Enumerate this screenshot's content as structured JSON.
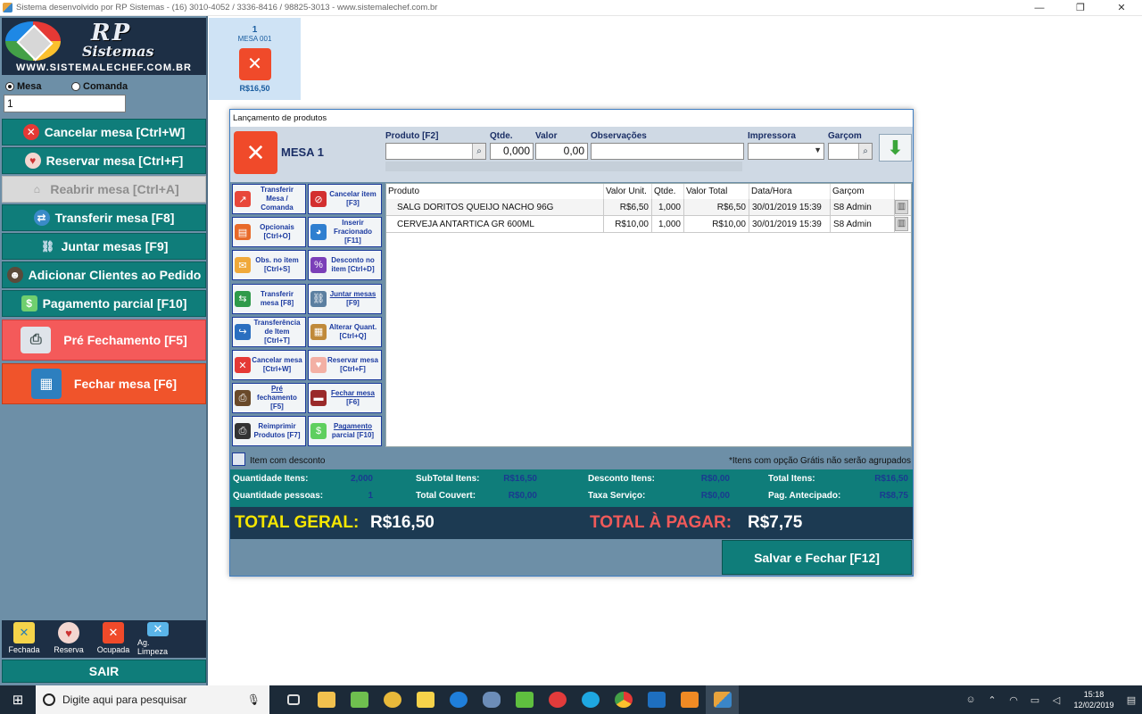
{
  "window": {
    "title": "Sistema desenvolvido por RP Sistemas - (16) 3010-4052 / 3336-8416 / 98825-3013 - www.sistemalechef.com.br",
    "minimize": "—",
    "restore": "❐",
    "close": "✕"
  },
  "logo": {
    "rp": "RP",
    "sistemas": "Sistemas",
    "url": "WWW.SISTEMALECHEF.COM.BR"
  },
  "left": {
    "radio_mesa": "Mesa",
    "radio_comanda": "Comanda",
    "mesa_value": "1",
    "buttons": {
      "cancelar": "Cancelar mesa [Ctrl+W]",
      "reservar": "Reservar mesa [Ctrl+F]",
      "reabrir": "Reabrir mesa [Ctrl+A]",
      "transferir": "Transferir mesa [F8]",
      "juntar": "Juntar mesas [F9]",
      "adicionar": "Adicionar Clientes ao Pedido",
      "pagamento": "Pagamento parcial [F10]",
      "pre_fechamento": "Pré Fechamento [F5]",
      "fechar": "Fechar mesa [F6]"
    },
    "legend": [
      "Fechada",
      "Reserva",
      "Ocupada",
      "Ag. Limpeza"
    ],
    "sair": "SAIR"
  },
  "tile": {
    "number": "1",
    "name": "MESA 001",
    "value": "R$16,50"
  },
  "dialog": {
    "title": "Lançamento de produtos",
    "mesa": "MESA 1",
    "labels": {
      "produto": "Produto [F2]",
      "qtde": "Qtde.",
      "valor": "Valor",
      "obs": "Observações",
      "impressora": "Impressora",
      "garcom": "Garçom"
    },
    "fields": {
      "produto": "",
      "qtde": "0,000",
      "valor": "0,00",
      "obs": "",
      "impressora": "",
      "garcom": ""
    },
    "actions": [
      [
        "Transferir",
        "Mesa /",
        "Comanda"
      ],
      [
        "Cancelar item",
        "[F3]"
      ],
      [
        "Opcionais",
        "[Ctrl+O]"
      ],
      [
        "Inserir",
        "Fracionado",
        "[F11]"
      ],
      [
        "Obs. no item",
        "[Ctrl+S]"
      ],
      [
        "Desconto no",
        "item [Ctrl+D]"
      ],
      [
        "Transferir",
        "mesa [F8]"
      ],
      [
        "Juntar mesas",
        "[F9]"
      ],
      [
        "Transferência",
        "de Item",
        "[Ctrl+T]"
      ],
      [
        "Alterar Quant.",
        "[Ctrl+Q]"
      ],
      [
        "Cancelar mesa",
        "[Ctrl+W]"
      ],
      [
        "Reservar mesa",
        "[Ctrl+F]"
      ],
      [
        "Pré",
        "fechamento",
        "[F5]"
      ],
      [
        "Fechar mesa",
        "[F6]"
      ],
      [
        "Reimprimir",
        "Produtos [F7]"
      ],
      [
        "Pagamento",
        "parcial [F10]"
      ]
    ],
    "grid": {
      "headers": [
        "Produto",
        "Valor Unit.",
        "Qtde.",
        "Valor Total",
        "Data/Hora",
        "Garçom"
      ],
      "rows": [
        [
          "SALG DORITOS QUEIJO NACHO 96G",
          "R$6,50",
          "1,000",
          "R$6,50",
          "30/01/2019 15:39",
          "S8 Admin"
        ],
        [
          "CERVEJA ANTARTICA GR 600ML",
          "R$10,00",
          "1,000",
          "R$10,00",
          "30/01/2019 15:39",
          "S8 Admin"
        ]
      ]
    },
    "checkbox_label": "Item com desconto",
    "note": "*Itens com opção Grátis não serão agrupados",
    "totals": {
      "qtd_itens_label": "Quantidade Itens:",
      "qtd_itens": "2,000",
      "qtd_pessoas_label": "Quantidade pessoas:",
      "qtd_pessoas": "1",
      "subtotal_label": "SubTotal Itens:",
      "subtotal": "R$16,50",
      "couvert_label": "Total Couvert:",
      "couvert": "R$0,00",
      "desconto_label": "Desconto Itens:",
      "desconto": "R$0,00",
      "taxa_label": "Taxa Serviço:",
      "taxa": "R$0,00",
      "total_itens_label": "Total Itens:",
      "total_itens": "R$16,50",
      "antecipado_label": "Pag. Antecipado:",
      "antecipado": "R$8,75"
    },
    "total_geral_label": "TOTAL GERAL:",
    "total_geral": "R$16,50",
    "total_pagar_label": "TOTAL À PAGAR:",
    "total_pagar": "R$7,75",
    "save": "Salvar e Fechar [F12]"
  },
  "taskbar": {
    "search_placeholder": "Digite aqui para pesquisar",
    "time": "15:18",
    "date": "12/02/2019"
  },
  "colors": {
    "teal": "#0f7d7a",
    "panel": "#6d8fa7",
    "red": "#f45a5a",
    "orange": "#f0542b",
    "navy": "#1c3a52"
  }
}
